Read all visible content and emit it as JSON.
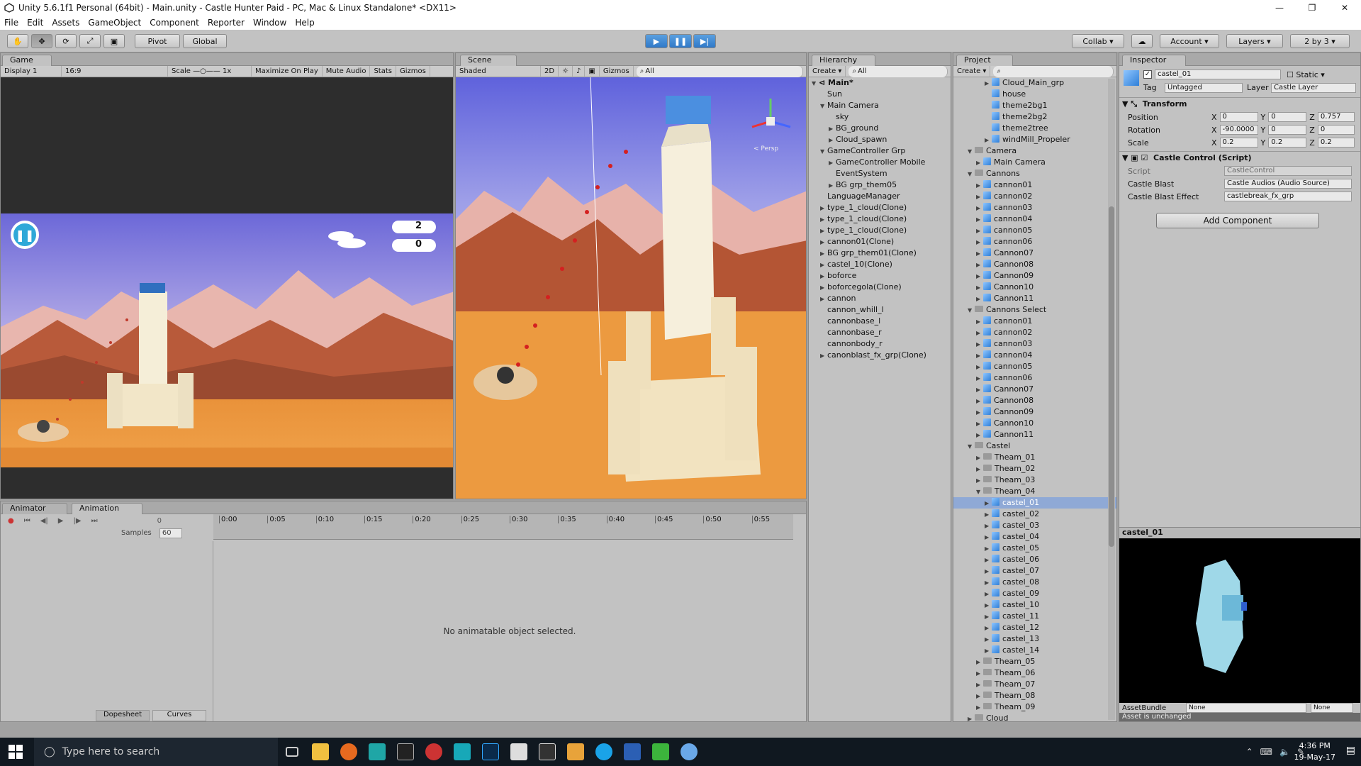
{
  "window": {
    "title": "Unity 5.6.1f1 Personal (64bit) - Main.unity - Castle Hunter Paid - PC, Mac & Linux Standalone* <DX11>"
  },
  "menu": [
    "File",
    "Edit",
    "Assets",
    "GameObject",
    "Component",
    "Reporter",
    "Window",
    "Help"
  ],
  "toolbar": {
    "pivot": "Pivot",
    "global": "Global",
    "collab": "Collab",
    "account": "Account",
    "layers": "Layers",
    "layout": "2 by 3"
  },
  "game": {
    "tab": "Game",
    "display": "Display 1",
    "aspect": "16:9",
    "scale": "Scale",
    "scale_val": "1x",
    "maximize": "Maximize On Play",
    "mute": "Mute Audio",
    "stats": "Stats",
    "gizmos": "Gizmos",
    "score1": "2",
    "score2": "0"
  },
  "scene": {
    "tab": "Scene",
    "shaded": "Shaded",
    "mode": "2D",
    "gizmos": "Gizmos",
    "search": "All",
    "persp": "< Persp"
  },
  "hierarchy": {
    "tab": "Hierarchy",
    "create": "Create",
    "search": "All",
    "scene": "Main*",
    "items": [
      {
        "l": "Sun",
        "d": 1,
        "a": ""
      },
      {
        "l": "Main Camera",
        "d": 1,
        "a": "▼"
      },
      {
        "l": "sky",
        "d": 2,
        "a": ""
      },
      {
        "l": "BG_ground",
        "d": 2,
        "a": "▶"
      },
      {
        "l": "Cloud_spawn",
        "d": 2,
        "a": "▶"
      },
      {
        "l": "GameController Grp",
        "d": 1,
        "a": "▼"
      },
      {
        "l": "GameController Mobile",
        "d": 2,
        "a": "▶"
      },
      {
        "l": "EventSystem",
        "d": 2,
        "a": ""
      },
      {
        "l": "BG grp_them05",
        "d": 2,
        "a": "▶"
      },
      {
        "l": "LanguageManager",
        "d": 1,
        "a": ""
      },
      {
        "l": "type_1_cloud(Clone)",
        "d": 1,
        "a": "▶"
      },
      {
        "l": "type_1_cloud(Clone)",
        "d": 1,
        "a": "▶"
      },
      {
        "l": "type_1_cloud(Clone)",
        "d": 1,
        "a": "▶"
      },
      {
        "l": "cannon01(Clone)",
        "d": 1,
        "a": "▶"
      },
      {
        "l": "BG grp_them01(Clone)",
        "d": 1,
        "a": "▶"
      },
      {
        "l": "castel_10(Clone)",
        "d": 1,
        "a": "▶"
      },
      {
        "l": "boforce",
        "d": 1,
        "a": "▶"
      },
      {
        "l": "boforcegola(Clone)",
        "d": 1,
        "a": "▶"
      },
      {
        "l": "cannon",
        "d": 1,
        "a": "▶"
      },
      {
        "l": "cannon_whill_l",
        "d": 1,
        "a": ""
      },
      {
        "l": "cannonbase_l",
        "d": 1,
        "a": ""
      },
      {
        "l": "cannonbase_r",
        "d": 1,
        "a": ""
      },
      {
        "l": "cannonbody_r",
        "d": 1,
        "a": ""
      },
      {
        "l": "canonblast_fx_grp(Clone)",
        "d": 1,
        "a": "▶"
      }
    ]
  },
  "project": {
    "tab": "Project",
    "create": "Create",
    "items": [
      {
        "l": "Cloud_Main_grp",
        "d": 2,
        "t": "c",
        "a": "▶"
      },
      {
        "l": "house",
        "d": 2,
        "t": "c",
        "a": ""
      },
      {
        "l": "theme2bg1",
        "d": 2,
        "t": "c",
        "a": ""
      },
      {
        "l": "theme2bg2",
        "d": 2,
        "t": "c",
        "a": ""
      },
      {
        "l": "theme2tree",
        "d": 2,
        "t": "c",
        "a": ""
      },
      {
        "l": "windMill_Propeler",
        "d": 2,
        "t": "c",
        "a": "▶"
      },
      {
        "l": "Camera",
        "d": 0,
        "t": "f",
        "a": "▼"
      },
      {
        "l": "Main Camera",
        "d": 1,
        "t": "c",
        "a": "▶"
      },
      {
        "l": "Cannons",
        "d": 0,
        "t": "f",
        "a": "▼"
      },
      {
        "l": "cannon01",
        "d": 1,
        "t": "c",
        "a": "▶"
      },
      {
        "l": "cannon02",
        "d": 1,
        "t": "c",
        "a": "▶"
      },
      {
        "l": "cannon03",
        "d": 1,
        "t": "c",
        "a": "▶"
      },
      {
        "l": "cannon04",
        "d": 1,
        "t": "c",
        "a": "▶"
      },
      {
        "l": "cannon05",
        "d": 1,
        "t": "c",
        "a": "▶"
      },
      {
        "l": "cannon06",
        "d": 1,
        "t": "c",
        "a": "▶"
      },
      {
        "l": "Cannon07",
        "d": 1,
        "t": "c",
        "a": "▶"
      },
      {
        "l": "Cannon08",
        "d": 1,
        "t": "c",
        "a": "▶"
      },
      {
        "l": "Cannon09",
        "d": 1,
        "t": "c",
        "a": "▶"
      },
      {
        "l": "Cannon10",
        "d": 1,
        "t": "c",
        "a": "▶"
      },
      {
        "l": "Cannon11",
        "d": 1,
        "t": "c",
        "a": "▶"
      },
      {
        "l": "Cannons Select",
        "d": 0,
        "t": "f",
        "a": "▼"
      },
      {
        "l": "cannon01",
        "d": 1,
        "t": "c",
        "a": "▶"
      },
      {
        "l": "cannon02",
        "d": 1,
        "t": "c",
        "a": "▶"
      },
      {
        "l": "cannon03",
        "d": 1,
        "t": "c",
        "a": "▶"
      },
      {
        "l": "cannon04",
        "d": 1,
        "t": "c",
        "a": "▶"
      },
      {
        "l": "cannon05",
        "d": 1,
        "t": "c",
        "a": "▶"
      },
      {
        "l": "cannon06",
        "d": 1,
        "t": "c",
        "a": "▶"
      },
      {
        "l": "Cannon07",
        "d": 1,
        "t": "c",
        "a": "▶"
      },
      {
        "l": "Cannon08",
        "d": 1,
        "t": "c",
        "a": "▶"
      },
      {
        "l": "Cannon09",
        "d": 1,
        "t": "c",
        "a": "▶"
      },
      {
        "l": "Cannon10",
        "d": 1,
        "t": "c",
        "a": "▶"
      },
      {
        "l": "Cannon11",
        "d": 1,
        "t": "c",
        "a": "▶"
      },
      {
        "l": "Castel",
        "d": 0,
        "t": "f",
        "a": "▼"
      },
      {
        "l": "Theam_01",
        "d": 1,
        "t": "f",
        "a": "▶"
      },
      {
        "l": "Theam_02",
        "d": 1,
        "t": "f",
        "a": "▶"
      },
      {
        "l": "Theam_03",
        "d": 1,
        "t": "f",
        "a": "▶"
      },
      {
        "l": "Theam_04",
        "d": 1,
        "t": "f",
        "a": "▼"
      },
      {
        "l": "castel_01",
        "d": 2,
        "t": "c",
        "a": "▶",
        "sel": true
      },
      {
        "l": "castel_02",
        "d": 2,
        "t": "c",
        "a": "▶"
      },
      {
        "l": "castel_03",
        "d": 2,
        "t": "c",
        "a": "▶"
      },
      {
        "l": "castel_04",
        "d": 2,
        "t": "c",
        "a": "▶"
      },
      {
        "l": "castel_05",
        "d": 2,
        "t": "c",
        "a": "▶"
      },
      {
        "l": "castel_06",
        "d": 2,
        "t": "c",
        "a": "▶"
      },
      {
        "l": "castel_07",
        "d": 2,
        "t": "c",
        "a": "▶"
      },
      {
        "l": "castel_08",
        "d": 2,
        "t": "c",
        "a": "▶"
      },
      {
        "l": "castel_09",
        "d": 2,
        "t": "c",
        "a": "▶"
      },
      {
        "l": "castel_10",
        "d": 2,
        "t": "c",
        "a": "▶"
      },
      {
        "l": "castel_11",
        "d": 2,
        "t": "c",
        "a": "▶"
      },
      {
        "l": "castel_12",
        "d": 2,
        "t": "c",
        "a": "▶"
      },
      {
        "l": "castel_13",
        "d": 2,
        "t": "c",
        "a": "▶"
      },
      {
        "l": "castel_14",
        "d": 2,
        "t": "c",
        "a": "▶"
      },
      {
        "l": "Theam_05",
        "d": 1,
        "t": "f",
        "a": "▶"
      },
      {
        "l": "Theam_06",
        "d": 1,
        "t": "f",
        "a": "▶"
      },
      {
        "l": "Theam_07",
        "d": 1,
        "t": "f",
        "a": "▶"
      },
      {
        "l": "Theam_08",
        "d": 1,
        "t": "f",
        "a": "▶"
      },
      {
        "l": "Theam_09",
        "d": 1,
        "t": "f",
        "a": "▶"
      },
      {
        "l": "Cloud",
        "d": 0,
        "t": "f",
        "a": "▶"
      }
    ]
  },
  "inspector": {
    "tab": "Inspector",
    "name": "castel_01",
    "static": "Static",
    "tag_label": "Tag",
    "tag": "Untagged",
    "layer_label": "Layer",
    "layer": "Castle Layer",
    "transform": "Transform",
    "position": "Position",
    "rotation": "Rotation",
    "scale": "Scale",
    "pos": {
      "x": "0",
      "y": "0",
      "z": "0.757"
    },
    "rot": {
      "x": "-90.0000",
      "y": "0",
      "z": "0"
    },
    "scl": {
      "x": "0.2",
      "y": "0.2",
      "z": "0.2"
    },
    "component": "Castle Control (Script)",
    "script_label": "Script",
    "script": "CastleControl",
    "blast_label": "Castle Blast",
    "blast": "Castle Audios (Audio Source)",
    "effect_label": "Castle Blast Effect",
    "effect": "castlebreak_fx_grp",
    "add_component": "Add Component",
    "preview_title": "castel_01",
    "assetbundle": "AssetBundle",
    "none1": "None",
    "none2": "None",
    "status": "Asset is unchanged"
  },
  "animation": {
    "tab_animator": "Animator",
    "tab_animation": "Animation",
    "samples": "Samples",
    "samples_val": "60",
    "frame": "0",
    "ticks": [
      "0:00",
      "0:05",
      "0:10",
      "0:15",
      "0:20",
      "0:25",
      "0:30",
      "0:35",
      "0:40",
      "0:45",
      "0:50",
      "0:55"
    ],
    "message": "No animatable object selected.",
    "dopesheet": "Dopesheet",
    "curves": "Curves"
  },
  "taskbar": {
    "search": "Type here to search",
    "time": "4:36 PM",
    "date": "19-May-17"
  }
}
